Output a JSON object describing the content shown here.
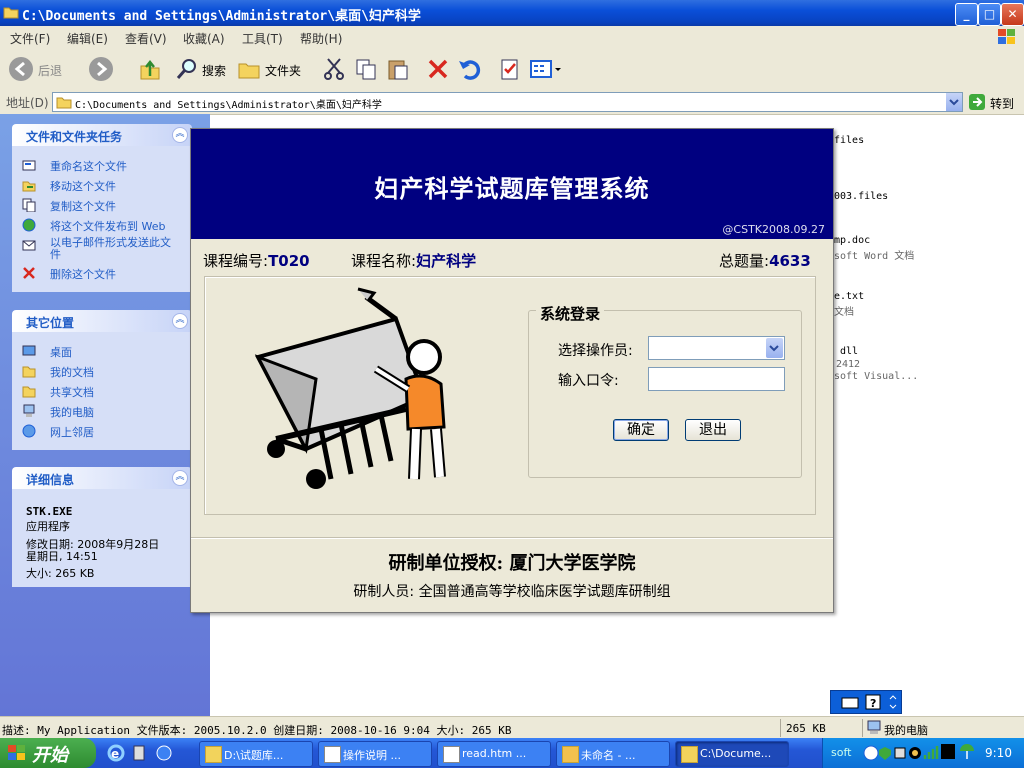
{
  "window": {
    "title": "C:\\Documents and Settings\\Administrator\\桌面\\妇产科学"
  },
  "menu": [
    "文件(F)",
    "编辑(E)",
    "查看(V)",
    "收藏(A)",
    "工具(T)",
    "帮助(H)"
  ],
  "toolbar": {
    "back": "后退",
    "search": "搜索",
    "folders": "文件夹"
  },
  "address": {
    "label": "地址(D)",
    "path": "C:\\Documents and Settings\\Administrator\\桌面\\妇产科学",
    "go": "转到"
  },
  "sidebar": {
    "tasks_title": "文件和文件夹任务",
    "tasks": [
      "重命名这个文件",
      "移动这个文件",
      "复制这个文件",
      "将这个文件发布到 Web",
      "以电子邮件形式发送此文件",
      "删除这个文件"
    ],
    "places_title": "其它位置",
    "places": [
      "桌面",
      "我的文档",
      "共享文档",
      "我的电脑",
      "网上邻居"
    ],
    "details_title": "详细信息",
    "details": {
      "name": "STK.EXE",
      "type": "应用程序",
      "modified_line1": "修改日期: 2008年9月28日",
      "modified_line2": "星期日, 14:51",
      "size": "大小: 265 KB"
    }
  },
  "files": {
    "f1": "files",
    "f2": "003.files",
    "f3": "mp.doc",
    "f3b": "soft Word 文档",
    "f4": "e.txt",
    "f4b": "文档",
    "f5": "dll",
    "f5b": "2412",
    "f5c": "soft Visual..."
  },
  "dialog": {
    "title": "妇产科学试题库管理系统",
    "version": "@CSTK2008.09.27",
    "course_code_label": "课程编号:",
    "course_code": "T020",
    "course_name_label": "课程名称:",
    "course_name": "妇产科学",
    "total_label": "总题量:",
    "total": "4633",
    "login_title": "系统登录",
    "operator_label": "选择操作员:",
    "password_label": "输入口令:",
    "ok": "确定",
    "exit": "退出",
    "credit1": "研制单位授权: 厦门大学医学院",
    "credit2": "研制人员: 全国普通高等学校临床医学试题库研制组"
  },
  "statusbar": {
    "desc": "描述: My Application 文件版本: 2005.10.2.0 创建日期: 2008-10-16 9:04 大小: 265 KB",
    "size": "265 KB",
    "zone": "我的电脑"
  },
  "taskbar": {
    "start": "开始",
    "items": [
      "D:\\试题库...",
      "操作说明 ...",
      "read.htm ...",
      "未命名 - ...",
      "C:\\Docume..."
    ],
    "tray_text": "soft",
    "clock": "9:10"
  }
}
